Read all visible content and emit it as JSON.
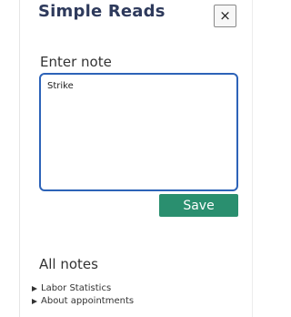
{
  "app": {
    "title": "Simple Reads",
    "close_label": "×"
  },
  "editor": {
    "label": "Enter note",
    "value": "Strike",
    "save_label": "Save"
  },
  "notes": {
    "heading": "All notes",
    "items": [
      {
        "label": "Labor Statistics"
      },
      {
        "label": "About appointments"
      }
    ]
  },
  "colors": {
    "title": "#2e3a5c",
    "textarea_border": "#2d63b8",
    "save_button": "#2a8f6f"
  },
  "icons": {
    "close": "close-icon",
    "disclosure": "disclosure-triangle-icon"
  }
}
